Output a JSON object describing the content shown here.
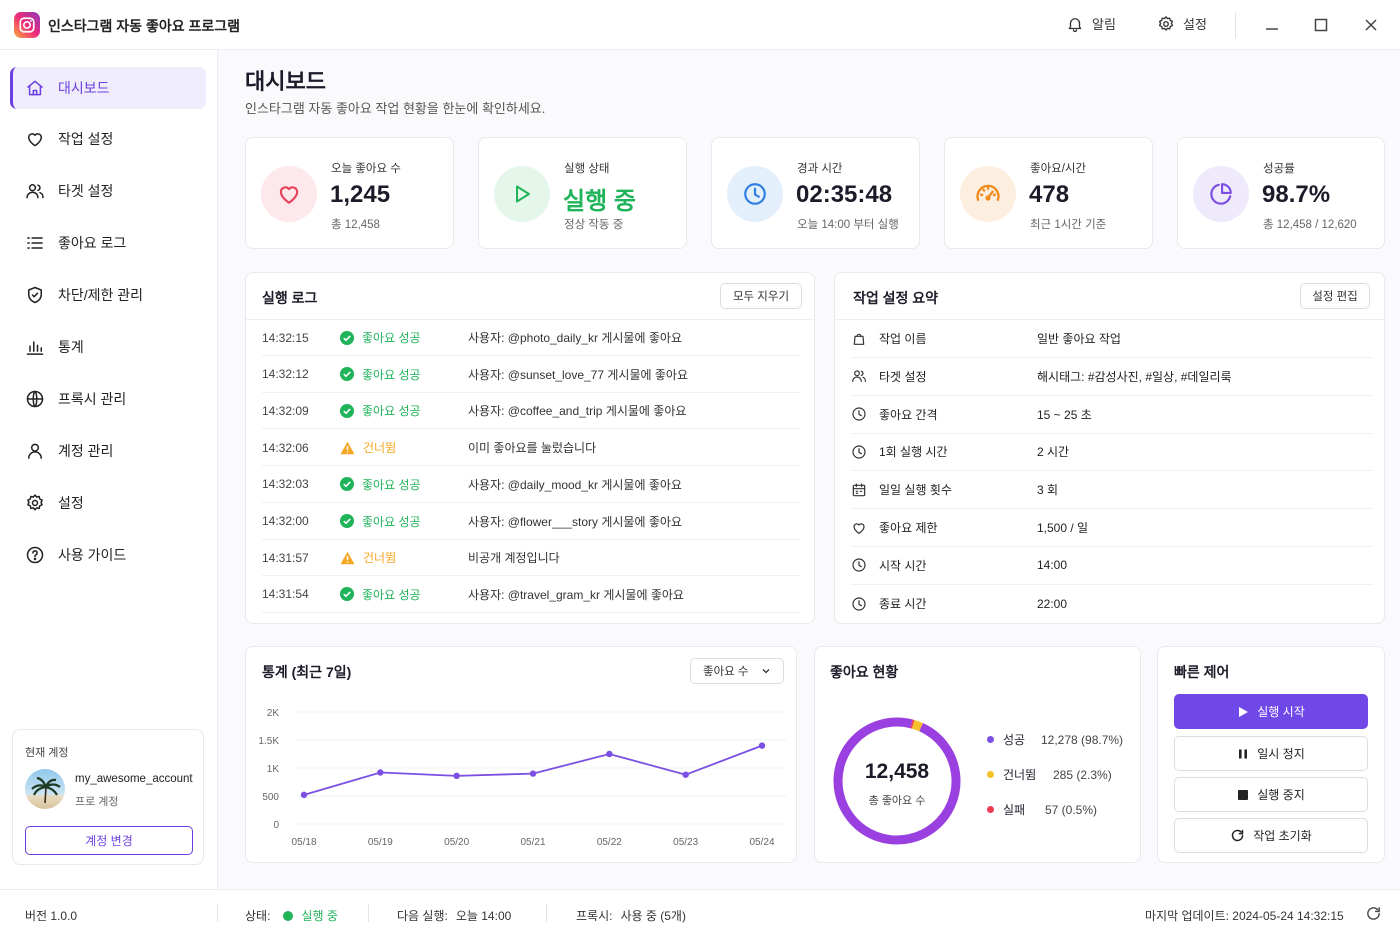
{
  "app": {
    "title": "인스타그램 자동 좋아요 프로그램",
    "notify_label": "알림",
    "settings_label": "설정"
  },
  "sidebar": {
    "items": [
      {
        "label": "대시보드",
        "icon": "home-icon"
      },
      {
        "label": "작업 설정",
        "icon": "heart-icon"
      },
      {
        "label": "타겟 설정",
        "icon": "users-icon"
      },
      {
        "label": "좋아요 로그",
        "icon": "list-icon"
      },
      {
        "label": "차단/제한 관리",
        "icon": "shield-icon"
      },
      {
        "label": "통계",
        "icon": "bar-chart-icon"
      },
      {
        "label": "프록시 관리",
        "icon": "globe-icon"
      },
      {
        "label": "계정 관리",
        "icon": "user-icon"
      },
      {
        "label": "설정",
        "icon": "gear-icon"
      },
      {
        "label": "사용 가이드",
        "icon": "help-icon"
      }
    ],
    "account": {
      "section_label": "현재 계정",
      "username": "my_awesome_account",
      "plan": "프로 계정",
      "switch_label": "계정 변경"
    }
  },
  "page": {
    "title": "대시보드",
    "subtitle": "인스타그램 자동 좋아요 작업 현황을 한눈에 확인하세요."
  },
  "stats": [
    {
      "label": "오늘 좋아요 수",
      "value": "1,245",
      "sub": "총 12,458",
      "icon": "heart-icon",
      "color": "#e8435a",
      "bg": "#fde8ec"
    },
    {
      "label": "실행 상태",
      "value": "실행 중",
      "sub": "정상 작동 중",
      "icon": "play-icon",
      "color": "#1fb35a",
      "bg": "#e4f7ea"
    },
    {
      "label": "경과 시간",
      "value": "02:35:48",
      "sub": "오늘 14:00 부터 실행",
      "icon": "clock-icon",
      "color": "#2f7fe0",
      "bg": "#e4effc"
    },
    {
      "label": "좋아요/시간",
      "value": "478",
      "sub": "최근 1시간 기준",
      "icon": "speedometer-icon",
      "color": "#f08a1c",
      "bg": "#fdefdf"
    },
    {
      "label": "성공률",
      "value": "98.7%",
      "sub": "총 12,458 / 12,620",
      "icon": "pie-chart-icon",
      "color": "#7b4fe3",
      "bg": "#efe9fc"
    }
  ],
  "log": {
    "title": "실행 로그",
    "clear_label": "모두 지우기",
    "rows": [
      {
        "time": "14:32:15",
        "status": "좋아요 성공",
        "type": "success",
        "message": "사용자: @photo_daily_kr 게시물에 좋아요"
      },
      {
        "time": "14:32:12",
        "status": "좋아요 성공",
        "type": "success",
        "message": "사용자: @sunset_love_77 게시물에 좋아요"
      },
      {
        "time": "14:32:09",
        "status": "좋아요 성공",
        "type": "success",
        "message": "사용자: @coffee_and_trip 게시물에 좋아요"
      },
      {
        "time": "14:32:06",
        "status": "건너뜀",
        "type": "skip",
        "message": "이미 좋아요를 눌렀습니다"
      },
      {
        "time": "14:32:03",
        "status": "좋아요 성공",
        "type": "success",
        "message": "사용자: @daily_mood_kr 게시물에 좋아요"
      },
      {
        "time": "14:32:00",
        "status": "좋아요 성공",
        "type": "success",
        "message": "사용자: @flower___story 게시물에 좋아요"
      },
      {
        "time": "14:31:57",
        "status": "건너뜀",
        "type": "skip",
        "message": "비공개 계정입니다"
      },
      {
        "time": "14:31:54",
        "status": "좋아요 성공",
        "type": "success",
        "message": "사용자: @travel_gram_kr 게시물에 좋아요"
      }
    ]
  },
  "summary": {
    "title": "작업 설정 요약",
    "edit_label": "설정 편집",
    "rows": [
      {
        "key": "작업 이름",
        "value": "일반 좋아요 작업",
        "icon": "bag-icon"
      },
      {
        "key": "타겟 설정",
        "value": "해시태그: #감성사진, #일상, #데일리룩",
        "icon": "users-icon"
      },
      {
        "key": "좋아요 간격",
        "value": "15 ~ 25 초",
        "icon": "clock-icon"
      },
      {
        "key": "1회 실행 시간",
        "value": "2 시간",
        "icon": "clock-icon"
      },
      {
        "key": "일일 실행 횟수",
        "value": "3 회",
        "icon": "calendar-icon"
      },
      {
        "key": "좋아요 제한",
        "value": "1,500 / 일",
        "icon": "heart-icon"
      },
      {
        "key": "시작 시간",
        "value": "14:00",
        "icon": "clock-icon"
      },
      {
        "key": "종료 시간",
        "value": "22:00",
        "icon": "clock-icon"
      }
    ]
  },
  "stats_chart": {
    "title": "통계 (최근 7일)",
    "select_label": "좋아요 수",
    "chart_data": {
      "type": "line",
      "categories": [
        "05/18",
        "05/19",
        "05/20",
        "05/21",
        "05/22",
        "05/23",
        "05/24"
      ],
      "series": [
        {
          "values": [
            520,
            920,
            860,
            900,
            1250,
            880,
            1400
          ],
          "color": "#7b4fe3"
        }
      ],
      "ylim": [
        0,
        2000
      ],
      "yticks": [
        "0",
        "500",
        "1K",
        "1.5K",
        "2K"
      ],
      "ytick_values": [
        0,
        500,
        1000,
        1500,
        2000
      ],
      "grid": true
    }
  },
  "like_status": {
    "title": "좋아요 현황",
    "total": "12,458",
    "total_label": "총 좋아요 수",
    "chart_data": {
      "type": "pie",
      "labels": [
        "성공",
        "건너뜀",
        "실패"
      ],
      "values": [
        12278,
        285,
        57
      ],
      "colors": [
        "#9a3fe0",
        "#f5c02a",
        "#ee3b52"
      ]
    },
    "legend": [
      {
        "label": "성공",
        "value": "12,278 (98.7%)",
        "color": "#7b4fe3"
      },
      {
        "label": "건너뜀",
        "value": "285 (2.3%)",
        "color": "#f5c02a"
      },
      {
        "label": "실패",
        "value": "57 (0.5%)",
        "color": "#ee3b52"
      }
    ]
  },
  "quick": {
    "title": "빠른 제어",
    "start": "실행 시작",
    "pause": "일시 정지",
    "stop": "실행 중지",
    "reset": "작업 초기화"
  },
  "statusbar": {
    "version": "버전 1.0.0",
    "status_label": "상태:",
    "status_value": "실행 중",
    "next_label": "다음 실행:",
    "next_value": "오늘 14:00",
    "proxy_label": "프록시:",
    "proxy_value": "사용 중 (5개)",
    "updated": "마지막 업데이트: 2024-05-24 14:32:15"
  },
  "colors": {
    "accent": "#6c3fe0",
    "success": "#1fb35a",
    "warning": "#f5a623"
  }
}
